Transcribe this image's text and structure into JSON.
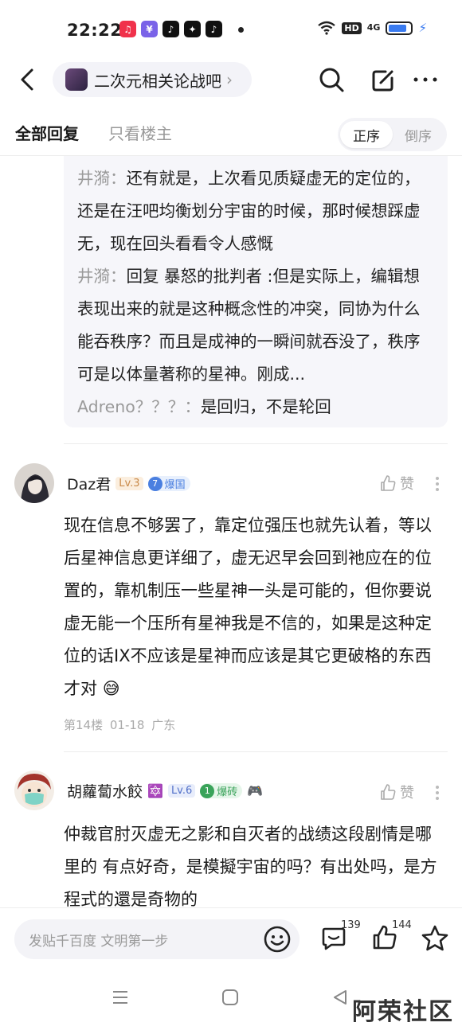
{
  "status_bar": {
    "time": "22:22",
    "hd": "HD",
    "network": "4G",
    "battery_level": 0.85
  },
  "header": {
    "forum_name": "二次元相关论战吧"
  },
  "tabs": {
    "all": "全部回复",
    "lz_only": "只看楼主",
    "asc": "正序",
    "desc": "倒序"
  },
  "subreplies": [
    {
      "author": "井漪",
      "sep": "：",
      "text": "还有就是，上次看见质疑虚无的定位的，还是在汪吧均衡划分宇宙的时候，那时候想踩虚无，现在回头看看令人感慨"
    },
    {
      "author": "井漪",
      "sep": "：",
      "text": "回复 暴怒的批判者 :但是实际上，编辑想表现出来的就是这种概念性的冲突，同协为什么能吞秩序？而且是成神的一瞬间就吞没了，秩序可是以体量著称的星神。刚成..."
    },
    {
      "author": "Adreno？？？",
      "sep": "：",
      "text": "是回归，不是轮回"
    }
  ],
  "posts": [
    {
      "username": "Daz君",
      "level": "Lv.3",
      "tag_num": "7",
      "tag_label": "爆国",
      "like_label": "赞",
      "text": "现在信息不够罢了，靠定位强压也就先认着，等以后星神信息更详细了，虚无迟早会回到祂应在的位置的，靠机制压一些星神一头是可能的，但你要说虚无能一个压所有星神我是不信的，如果是这种定位的话IX不应该是星神而应该是其它更破格的东西才对",
      "emoji": "😅",
      "floor": "第14楼",
      "date": "01-18",
      "location": "广东"
    },
    {
      "username": "胡蘿蔔水餃",
      "name_emoji": "🔯",
      "level": "Lv.6",
      "tag_num": "1",
      "tag_label": "爆砖",
      "extra_emoji": "🎮",
      "like_label": "赞",
      "text": "仲裁官肘灭虚无之影和自灭者的战绩这段剧情是哪里的 有点好奇，是模擬宇宙的吗？有出处吗，是方程式的還是奇物的"
    }
  ],
  "bottom_bar": {
    "placeholder": "发贴千百度 文明第一步",
    "comment_count": "139",
    "like_count": "144"
  },
  "watermark": "阿荣社区"
}
